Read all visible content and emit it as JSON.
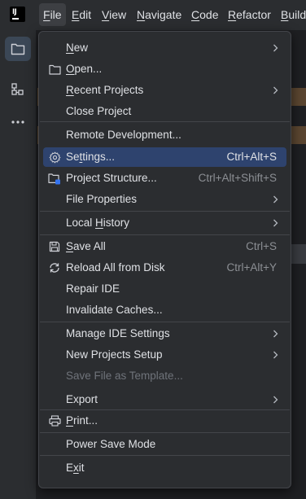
{
  "app": {
    "logo_text": "IJ"
  },
  "menubar": {
    "items": [
      {
        "label": "File",
        "mnemonic": "F",
        "rest": "ile"
      },
      {
        "label": "Edit",
        "mnemonic": "E",
        "rest": "dit"
      },
      {
        "label": "View",
        "mnemonic": "V",
        "rest": "iew"
      },
      {
        "label": "Navigate",
        "mnemonic": "N",
        "rest": "avigate"
      },
      {
        "label": "Code",
        "mnemonic": "C",
        "rest": "ode"
      },
      {
        "label": "Refactor",
        "mnemonic": "R",
        "rest": "efactor"
      },
      {
        "label": "Build",
        "mnemonic": "B",
        "rest": "uild"
      }
    ]
  },
  "toolstrip": {
    "items": [
      {
        "icon": "folder-icon"
      },
      {
        "icon": "structure-icon"
      },
      {
        "icon": "more-icon"
      }
    ]
  },
  "file_menu": {
    "items": [
      {
        "pre": "",
        "mn": "N",
        "post": "ew",
        "shortcut": "",
        "submenu": true,
        "icon": ""
      },
      {
        "pre": "",
        "mn": "O",
        "post": "pen...",
        "shortcut": "",
        "submenu": false,
        "icon": "folder-icon"
      },
      {
        "pre": "",
        "mn": "R",
        "post": "ecent Projects",
        "shortcut": "",
        "submenu": true,
        "icon": ""
      },
      {
        "pre": "Close Project",
        "mn": "",
        "post": "",
        "shortcut": "",
        "submenu": false,
        "icon": ""
      },
      {
        "pre": "Remote Development...",
        "mn": "",
        "post": "",
        "shortcut": "",
        "submenu": false,
        "icon": ""
      },
      {
        "pre": "Se",
        "mn": "t",
        "post": "tings...",
        "shortcut": "Ctrl+Alt+S",
        "submenu": false,
        "icon": "gear-icon",
        "highlighted": true
      },
      {
        "pre": "Project Structure...",
        "mn": "",
        "post": "",
        "shortcut": "Ctrl+Alt+Shift+S",
        "submenu": false,
        "icon": "project-structure-icon"
      },
      {
        "pre": "File Properties",
        "mn": "",
        "post": "",
        "shortcut": "",
        "submenu": true,
        "icon": ""
      },
      {
        "pre": "Local ",
        "mn": "H",
        "post": "istory",
        "shortcut": "",
        "submenu": true,
        "icon": ""
      },
      {
        "pre": "",
        "mn": "S",
        "post": "ave All",
        "shortcut": "Ctrl+S",
        "submenu": false,
        "icon": "save-icon"
      },
      {
        "pre": "Reload All from Disk",
        "mn": "",
        "post": "",
        "shortcut": "Ctrl+Alt+Y",
        "submenu": false,
        "icon": "reload-icon"
      },
      {
        "pre": "Repair IDE",
        "mn": "",
        "post": "",
        "shortcut": "",
        "submenu": false,
        "icon": ""
      },
      {
        "pre": "Invalidate Caches...",
        "mn": "",
        "post": "",
        "shortcut": "",
        "submenu": false,
        "icon": ""
      },
      {
        "pre": "Manage IDE Settings",
        "mn": "",
        "post": "",
        "shortcut": "",
        "submenu": true,
        "icon": ""
      },
      {
        "pre": "New Projects Setup",
        "mn": "",
        "post": "",
        "shortcut": "",
        "submenu": true,
        "icon": ""
      },
      {
        "pre": "Save File as Template...",
        "mn": "",
        "post": "",
        "shortcut": "",
        "submenu": false,
        "icon": "",
        "disabled": true
      },
      {
        "pre": "Export",
        "mn": "",
        "post": "",
        "shortcut": "",
        "submenu": true,
        "icon": ""
      },
      {
        "pre": "",
        "mn": "P",
        "post": "rint...",
        "shortcut": "",
        "submenu": false,
        "icon": "print-icon"
      },
      {
        "pre": "Power Save Mode",
        "mn": "",
        "post": "",
        "shortcut": "",
        "submenu": false,
        "icon": ""
      },
      {
        "pre": "E",
        "mn": "x",
        "post": "it",
        "shortcut": "",
        "submenu": false,
        "icon": ""
      }
    ]
  },
  "colors": {
    "menu_bg": "#2b2d30",
    "highlight": "#2e436e",
    "text": "#dfe1e5",
    "shortcut_text": "#8c8f94",
    "disabled_text": "#6f737a",
    "separator": "#43454a"
  }
}
